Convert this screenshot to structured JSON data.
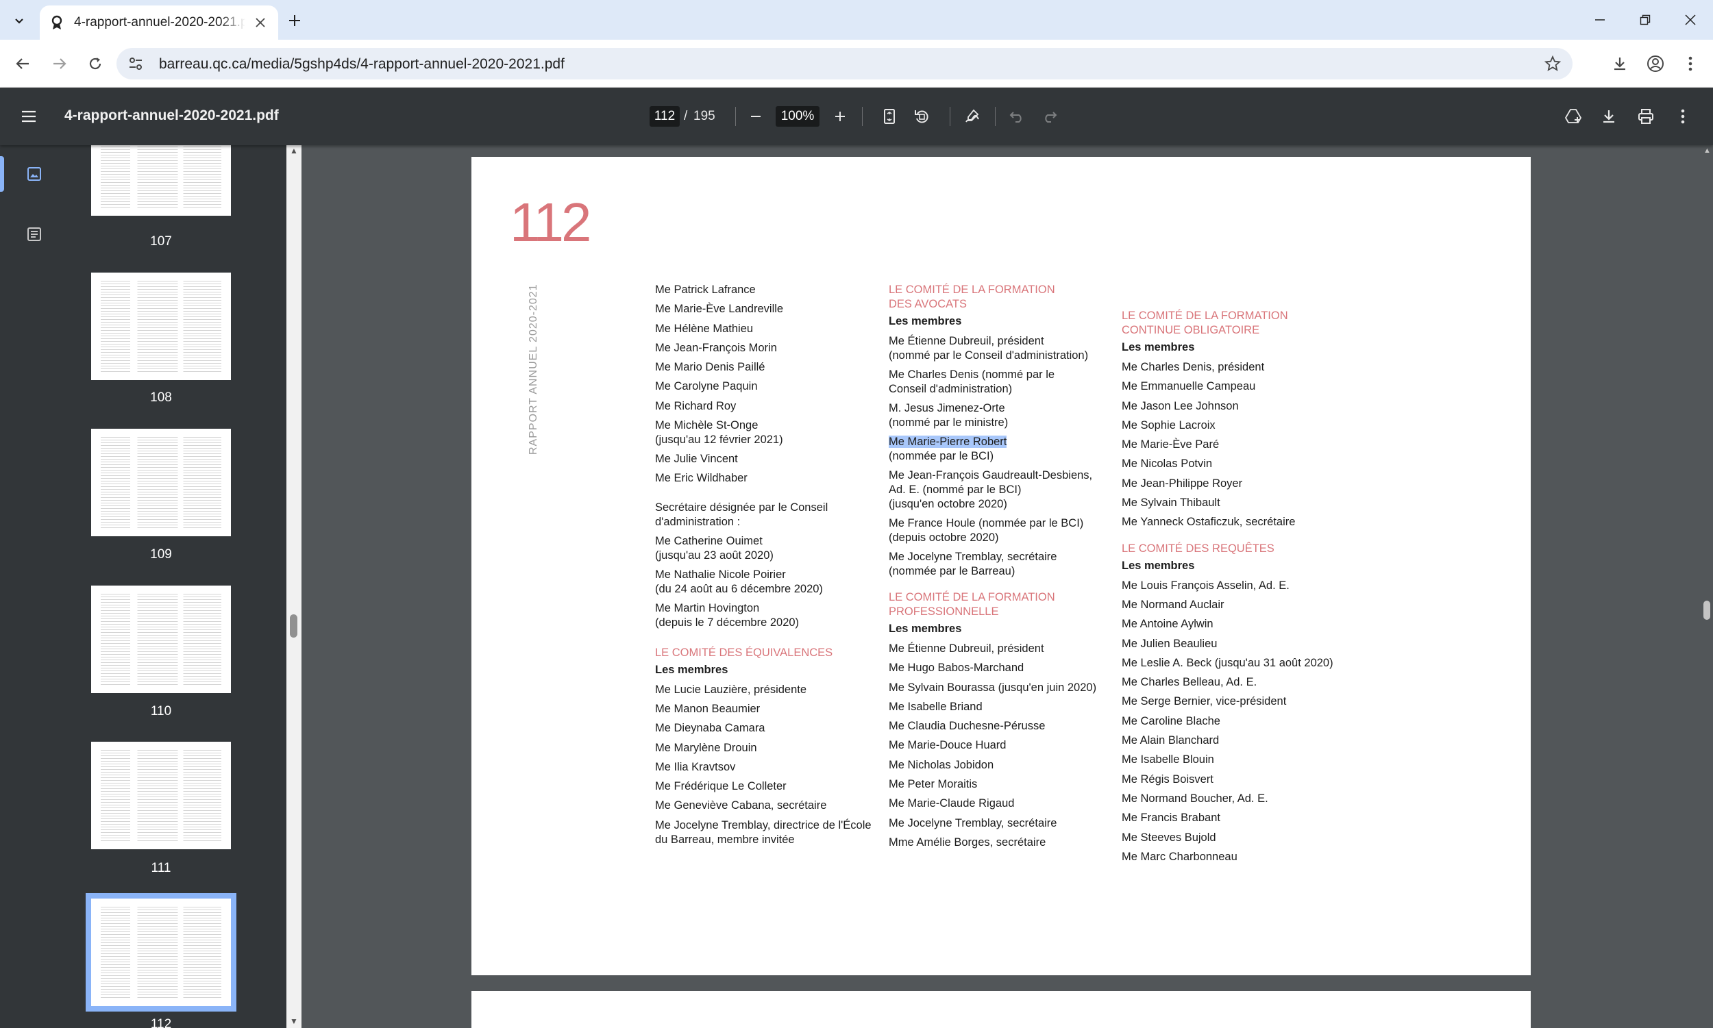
{
  "tab": {
    "title": "4-rapport-annuel-2020-2021.pdf"
  },
  "address": {
    "url": "barreau.qc.ca/media/5gshp4ds/4-rapport-annuel-2020-2021.pdf"
  },
  "pdf_toolbar": {
    "title": "4-rapport-annuel-2020-2021.pdf",
    "current_page": "112",
    "page_separator": "/",
    "total_pages": "195",
    "zoom": "100%"
  },
  "thumbnails": [
    {
      "label": "107"
    },
    {
      "label": "108"
    },
    {
      "label": "109"
    },
    {
      "label": "110"
    },
    {
      "label": "111"
    },
    {
      "label": "112"
    }
  ],
  "page": {
    "number": "112",
    "side_text": "RAPPORT ANNUEL 2020-2021",
    "col1": {
      "members": [
        "Me Patrick Lafrance",
        "Me Marie-Ève Landreville",
        "Me Hélène Mathieu",
        "Me Jean-François Morin",
        "Me Mario Denis Paillé",
        "Me Carolyne Paquin",
        "Me Richard Roy"
      ],
      "stonge_1": "Me Michèle St-Onge",
      "stonge_2": "(jusqu'au 12 février 2021)",
      "vincent": "Me Julie Vincent",
      "wildhaber": "Me Eric Wildhaber",
      "secretary_1": "Secrétaire désignée par le Conseil",
      "secretary_2": "d'administration :",
      "ouimet_1": "Me Catherine Ouimet",
      "ouimet_2": "(jusqu'au 23 août 2020)",
      "poirier_1": "Me Nathalie Nicole Poirier",
      "poirier_2": "(du 24 août au 6 décembre 2020)",
      "hovington_1": "Me Martin Hovington",
      "hovington_2": "(depuis le 7 décembre 2020)",
      "equiv_heading": "LE COMITÉ DES ÉQUIVALENCES",
      "equiv_sub": "Les membres",
      "equiv_members": [
        "Me Lucie Lauzière, présidente",
        "Me Manon Beaumier",
        "Me Dieynaba Camara",
        "Me Marylène Drouin",
        "Me Ilia Kravtsov",
        "Me Frédérique Le Colleter",
        "Me Geneviève Cabana, secrétaire"
      ],
      "tremblay_1": "Me Jocelyne Tremblay, directrice de l'École",
      "tremblay_2": "du Barreau, membre invitée"
    },
    "col2": {
      "h1_1": "LE COMITÉ DE LA FORMATION",
      "h1_2": "DES AVOCATS",
      "sub1": "Les membres",
      "dubreuil_1": "Me Étienne Dubreuil, président",
      "dubreuil_2": "(nommé par le Conseil d'administration)",
      "denis_1": "Me Charles Denis (nommé par le",
      "denis_2": "Conseil d'administration)",
      "jimenez_1": "M. Jesus Jimenez-Orte",
      "jimenez_2": "(nommé par le ministre)",
      "robert_1": "Me Marie-Pierre Robert",
      "robert_2": "(nommée par le BCI)",
      "gaudreault_1": "Me Jean-François Gaudreault-Desbiens,",
      "gaudreault_2": "Ad. E. (nommé par le BCI)",
      "gaudreault_3": "(jusqu'en octobre 2020)",
      "houle_1": "Me France Houle (nommée par le BCI)",
      "houle_2": "(depuis octobre 2020)",
      "tremblay_1": "Me Jocelyne Tremblay, secrétaire",
      "tremblay_2": "(nommée par le Barreau)",
      "h2_1": "LE COMITÉ DE LA FORMATION",
      "h2_2": "PROFESSIONNELLE",
      "sub2": "Les membres",
      "prof_members": [
        "Me Étienne Dubreuil, président",
        "Me Hugo Babos-Marchand",
        "Me Sylvain Bourassa (jusqu'en juin 2020)",
        "Me Isabelle Briand",
        "Me Claudia Duchesne-Pérusse",
        "Me Marie-Douce Huard",
        "Me Nicholas Jobidon",
        "Me Peter Moraitis",
        "Me Marie-Claude Rigaud",
        "Me Jocelyne Tremblay, secrétaire",
        "Mme Amélie Borges, secrétaire"
      ]
    },
    "col3": {
      "h1_1": "LE COMITÉ DE LA FORMATION",
      "h1_2": "CONTINUE OBLIGATOIRE",
      "sub1": "Les membres",
      "fco_members": [
        "Me Charles Denis, président",
        "Me Emmanuelle Campeau",
        "Me Jason Lee Johnson",
        "Me Sophie Lacroix",
        "Me Marie-Ève Paré",
        "Me Nicolas Potvin",
        "Me Jean-Philippe Royer",
        "Me Sylvain Thibault",
        "Me Yanneck Ostaficzuk, secrétaire"
      ],
      "h2": "LE COMITÉ DES REQUÊTES",
      "sub2": "Les membres",
      "req_members": [
        "Me Louis François Asselin, Ad. E.",
        "Me Normand Auclair",
        "Me Antoine Aylwin",
        "Me Julien Beaulieu",
        "Me Leslie A. Beck (jusqu'au 31 août 2020)",
        "Me Charles Belleau, Ad. E.",
        "Me Serge Bernier, vice-président",
        "Me Caroline Blache",
        "Me Alain Blanchard",
        "Me Isabelle Blouin",
        "Me Régis Boisvert",
        "Me Normand Boucher, Ad. E.",
        "Me Francis Brabant",
        "Me Steeves Bujold",
        "Me Marc Charbonneau"
      ]
    }
  }
}
